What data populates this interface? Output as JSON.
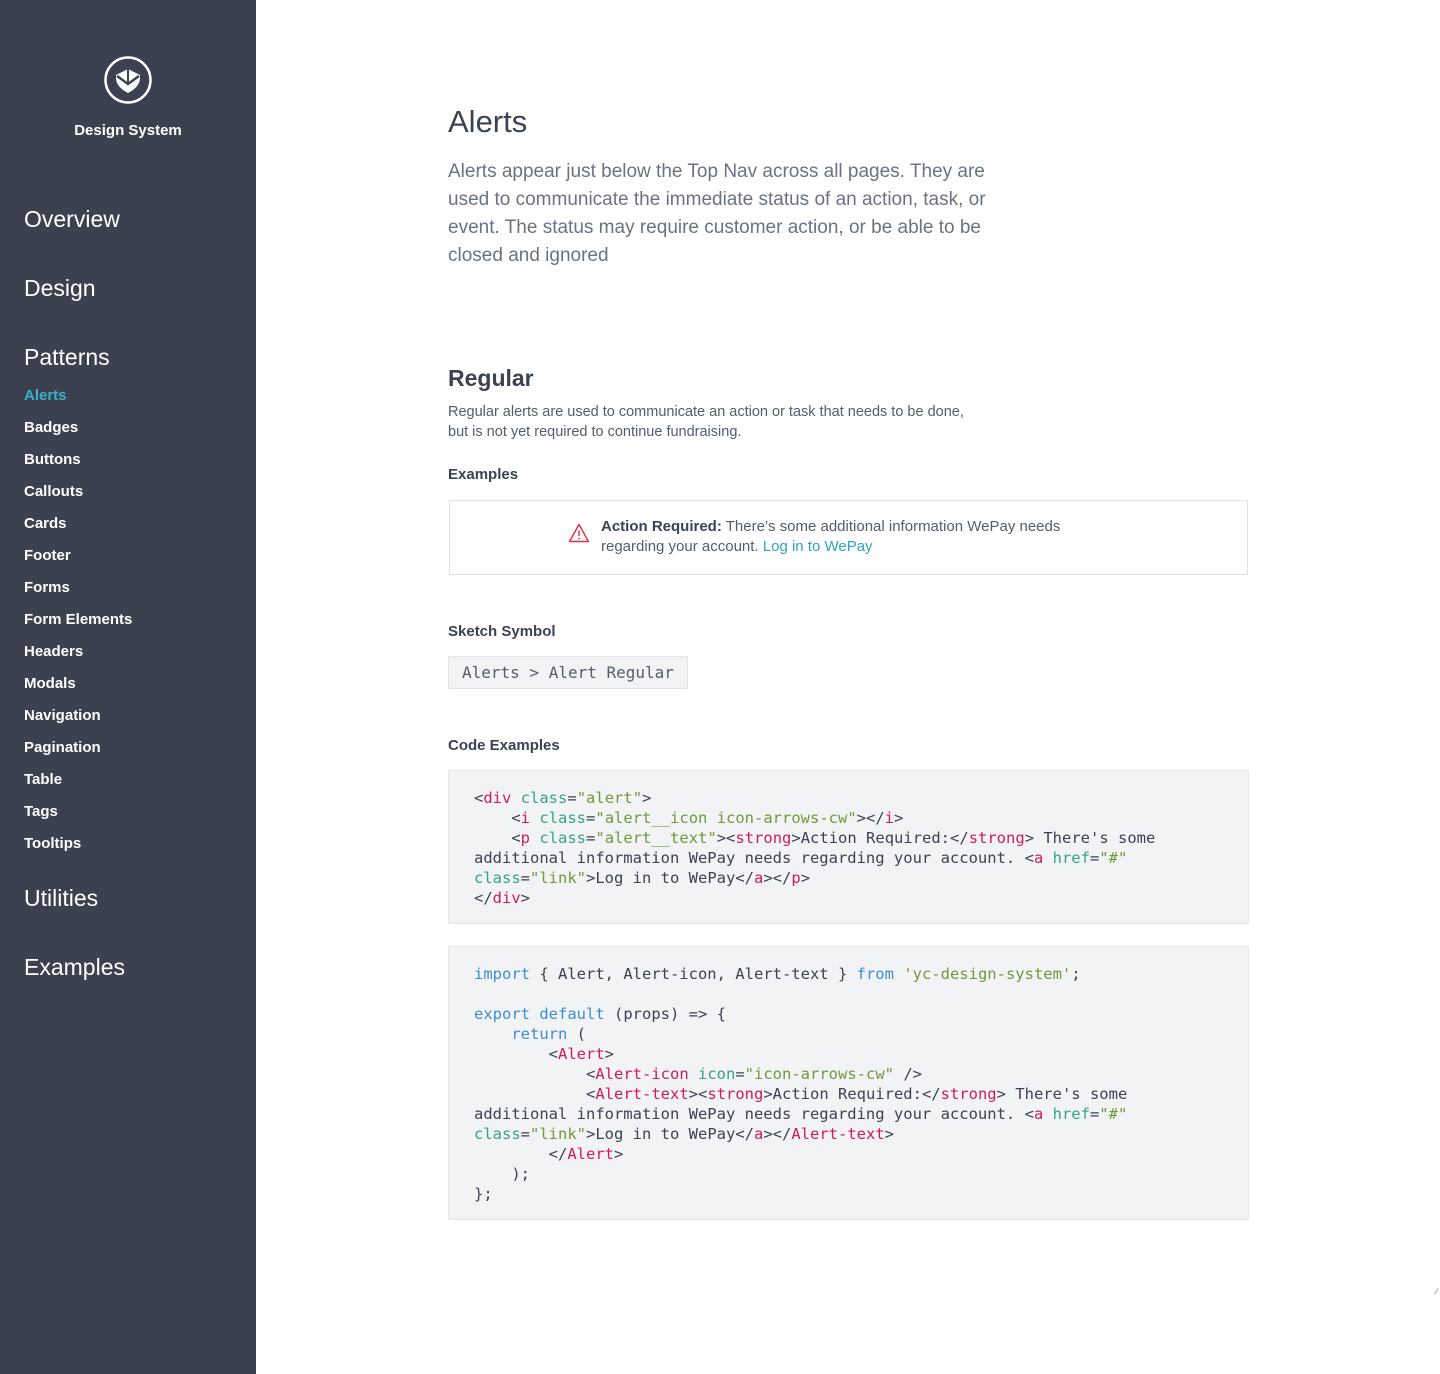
{
  "brand": {
    "name": "Design System"
  },
  "sidebar": {
    "sections": [
      {
        "label": "Overview"
      },
      {
        "label": "Design"
      },
      {
        "label": "Patterns"
      },
      {
        "label": "Utilities"
      },
      {
        "label": "Examples"
      }
    ],
    "items": [
      {
        "label": "Alerts",
        "active": true
      },
      {
        "label": "Badges"
      },
      {
        "label": "Buttons"
      },
      {
        "label": "Callouts"
      },
      {
        "label": "Cards"
      },
      {
        "label": "Footer"
      },
      {
        "label": "Forms"
      },
      {
        "label": "Form Elements"
      },
      {
        "label": "Headers"
      },
      {
        "label": "Modals"
      },
      {
        "label": "Navigation"
      },
      {
        "label": "Pagination"
      },
      {
        "label": "Table"
      },
      {
        "label": "Tags"
      },
      {
        "label": "Tooltips"
      }
    ]
  },
  "page": {
    "title": "Alerts",
    "intro": "Alerts appear just below the Top Nav across all pages. They are used to communicate the immediate status of an action, task, or event. The status may require customer action, or be able to be closed and ignored"
  },
  "section": {
    "title": "Regular",
    "description": "Regular alerts are used to communicate an action or task that needs to be done, but is not yet required to continue fundraising.",
    "examples_label": "Examples",
    "sketch_label": "Sketch Symbol",
    "sketch_symbol": "Alerts > Alert Regular",
    "code_label": "Code Examples"
  },
  "alert": {
    "strong": "Action Required:",
    "text": " There’s some additional information WePay needs regarding your account. ",
    "link": "Log in to WePay"
  },
  "colors": {
    "sidebar": "#3c4150",
    "accent": "#38b2c6",
    "alert_icon": "#e2344d",
    "link": "#2fa3c1"
  }
}
